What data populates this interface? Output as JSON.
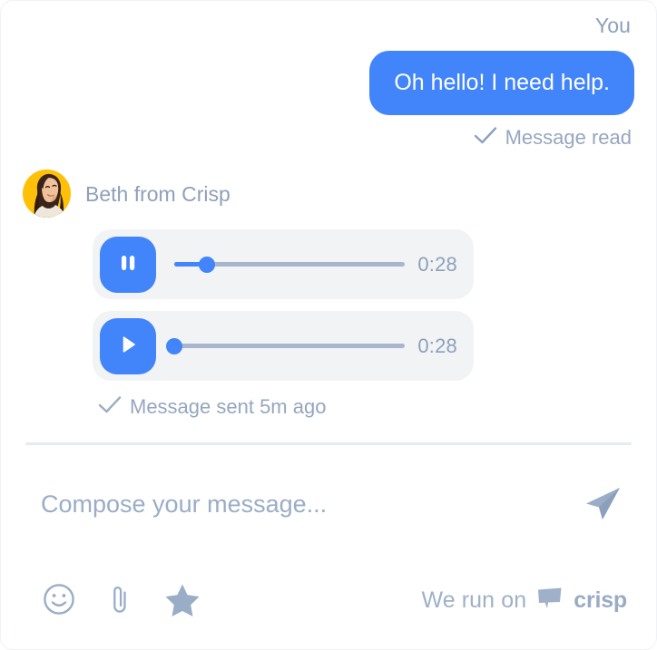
{
  "theme": {
    "accent_blue": "#4285FB",
    "muted_text": "#8fa0ba",
    "player_bg": "#f1f3f5",
    "track_color": "#a7b6cc",
    "divider": "#e6eaf2",
    "avatar_bg": "#FFC107",
    "bubble_text": "#ffffff"
  },
  "conversation": {
    "outgoing": {
      "sender": "You",
      "text": "Oh hello! I need help.",
      "receipt": "Message read",
      "receipt_icon": "check-icon"
    },
    "incoming": {
      "sender": "Beth from Crisp",
      "avatar_icon": "avatar-photo",
      "receipt": "Message sent 5m ago",
      "receipt_icon": "check-icon",
      "audio_messages": [
        {
          "state": "playing",
          "button_icon": "pause-icon",
          "duration": "0:28",
          "progress_percent": 14
        },
        {
          "state": "paused",
          "button_icon": "play-icon",
          "duration": "0:28",
          "progress_percent": 0
        }
      ]
    }
  },
  "compose": {
    "placeholder": "Compose your message...",
    "value": "",
    "send_icon": "send-paper-plane-icon"
  },
  "toolbar": {
    "actions": [
      {
        "icon": "smiley-icon",
        "label": "Insert emoji"
      },
      {
        "icon": "paperclip-icon",
        "label": "Attach file"
      },
      {
        "icon": "star-icon",
        "label": "Rate conversation"
      }
    ],
    "branding": {
      "prefix": "We run on",
      "logo_icon": "crisp-bubble-icon",
      "name": "crisp"
    }
  }
}
